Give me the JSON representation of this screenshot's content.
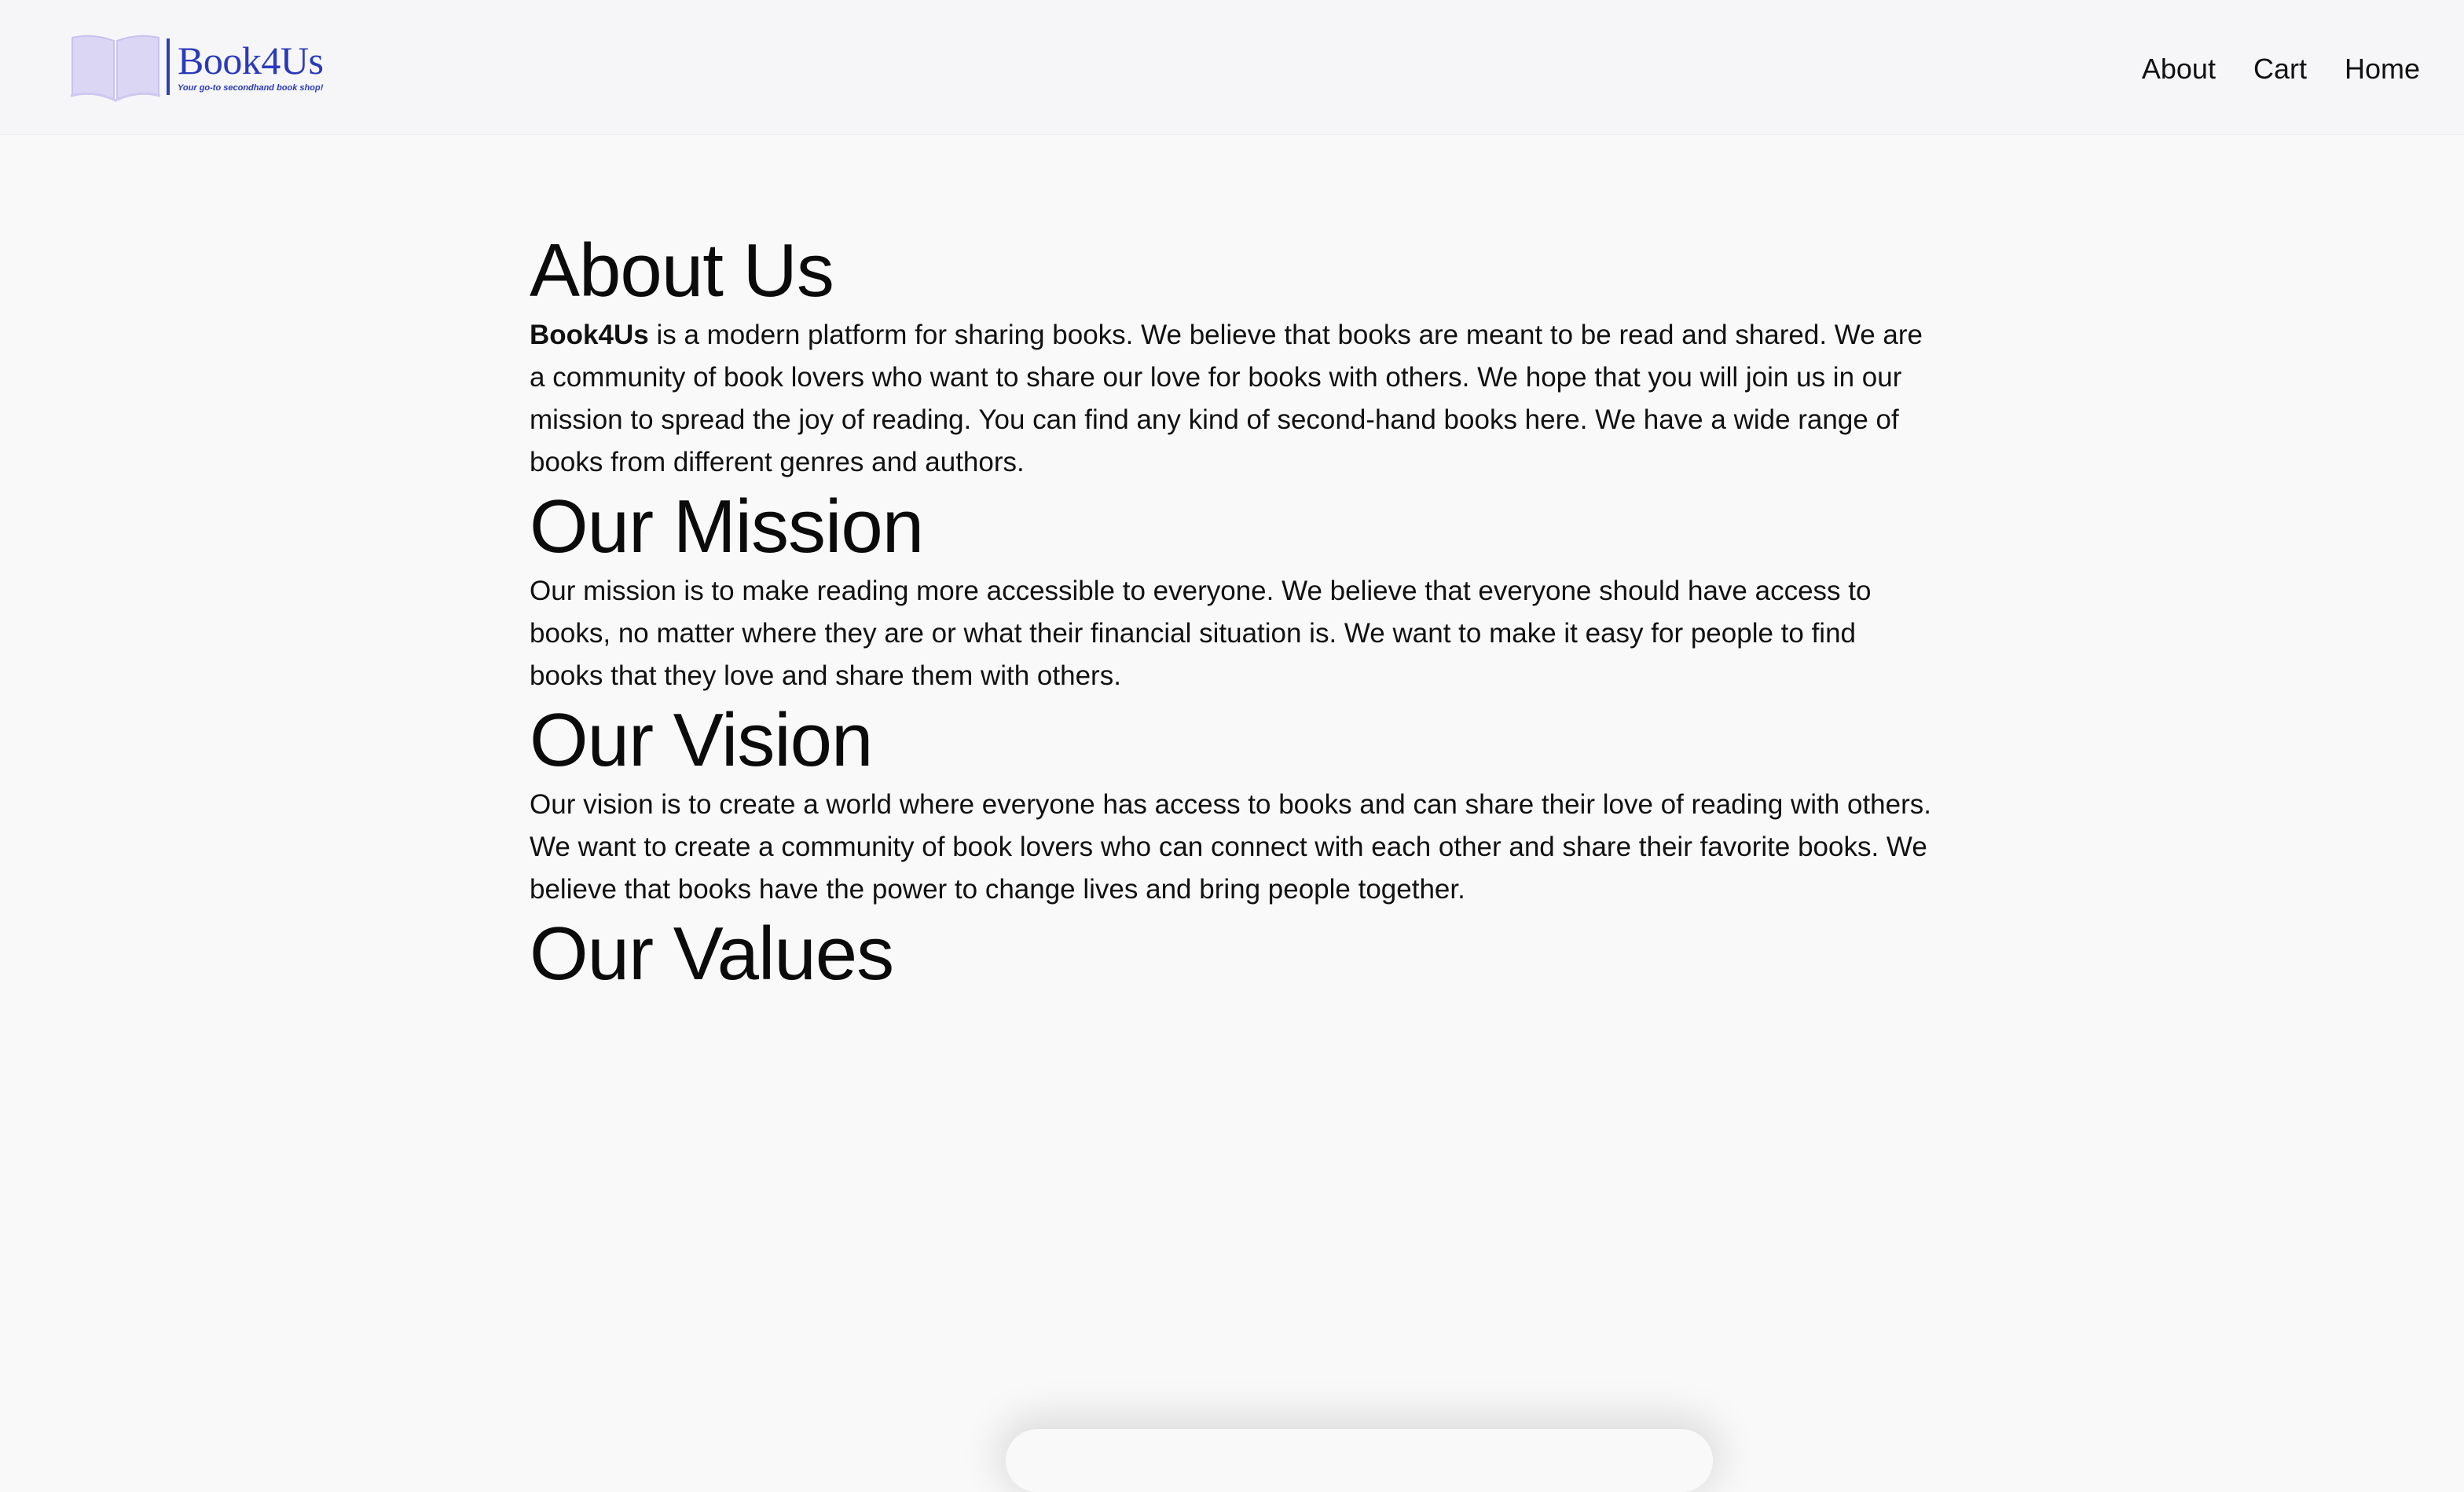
{
  "header": {
    "logo_title": "Book4Us",
    "logo_tagline": "Your go-to secondhand book shop!",
    "nav": [
      {
        "label": "About"
      },
      {
        "label": "Cart"
      },
      {
        "label": "Home"
      }
    ]
  },
  "sections": {
    "about": {
      "title": "About Us",
      "brand": "Book4Us",
      "text": " is a modern platform for sharing books. We believe that books are meant to be read and shared. We are a community of book lovers who want to share our love for books with others. We hope that you will join us in our mission to spread the joy of reading. You can find any kind of second-hand books here. We have a wide range of books from different genres and authors."
    },
    "mission": {
      "title": "Our Mission",
      "text": "Our mission is to make reading more accessible to everyone. We believe that everyone should have access to books, no matter where they are or what their financial situation is. We want to make it easy for people to find books that they love and share them with others."
    },
    "vision": {
      "title": "Our Vision",
      "text": "Our vision is to create a world where everyone has access to books and can share their love of reading with others. We want to create a community of book lovers who can connect with each other and share their favorite books. We believe that books have the power to change lives and bring people together."
    },
    "values": {
      "title": "Our Values"
    }
  },
  "colors": {
    "brand_blue": "#2a3ab8",
    "logo_book_fill": "#dcd6f5",
    "page_bg": "#f9f9f9",
    "navbar_bg": "#f6f6f8"
  }
}
